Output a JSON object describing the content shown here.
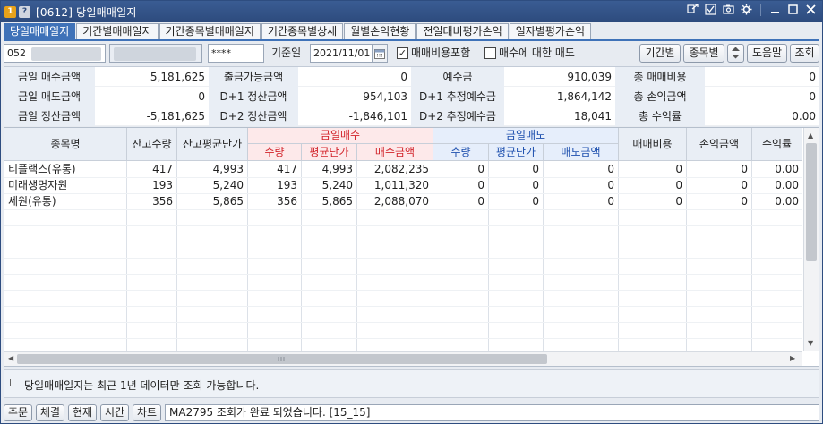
{
  "window": {
    "badge_1": "1",
    "badge_q": "?",
    "title": "[0612] 당일매매일지"
  },
  "tabs": [
    {
      "label": "당일매매일지",
      "active": true
    },
    {
      "label": "기간별매매일지",
      "active": false
    },
    {
      "label": "기간종목별매매일지",
      "active": false
    },
    {
      "label": "기간종목별상세",
      "active": false
    },
    {
      "label": "월별손익현황",
      "active": false
    },
    {
      "label": "전일대비평가손익",
      "active": false
    },
    {
      "label": "일자별평가손익",
      "active": false
    }
  ],
  "query": {
    "account_prefix": "052",
    "password": "****",
    "date_label": "기준일",
    "date_value": "2021/11/01",
    "include_fee_label": "매매비용포함",
    "include_fee_checked": true,
    "sell_on_buy_label": "매수에 대한 매도",
    "sell_on_buy_checked": false,
    "btn_period": "기간별",
    "btn_item": "종목별",
    "btn_help": "도움말",
    "btn_query": "조회"
  },
  "summary": {
    "rows": [
      [
        {
          "label": "금일 매수금액",
          "value": "5,181,625"
        },
        {
          "label": "출금가능금액",
          "value": "0"
        },
        {
          "label": "예수금",
          "value": "910,039"
        },
        {
          "label": "총 매매비용",
          "value": "0"
        }
      ],
      [
        {
          "label": "금일 매도금액",
          "value": "0"
        },
        {
          "label": "D+1 정산금액",
          "value": "954,103"
        },
        {
          "label": "D+1 추정예수금",
          "value": "1,864,142"
        },
        {
          "label": "총 손익금액",
          "value": "0"
        }
      ],
      [
        {
          "label": "금일 정산금액",
          "value": "-5,181,625"
        },
        {
          "label": "D+2 정산금액",
          "value": "-1,846,101"
        },
        {
          "label": "D+2 추정예수금",
          "value": "18,041"
        },
        {
          "label": "총 수익률",
          "value": "0.00"
        }
      ]
    ]
  },
  "table": {
    "headers": {
      "name": "종목명",
      "hold_qty": "잔고수량",
      "hold_avg": "잔고평균단가",
      "buy_group": "금일매수",
      "buy_qty": "수량",
      "buy_avg": "평균단가",
      "buy_amt": "매수금액",
      "sell_group": "금일매도",
      "sell_qty": "수량",
      "sell_avg": "평균단가",
      "sell_amt": "매도금액",
      "fee": "매매비용",
      "pnl": "손익금액",
      "rate": "수익률"
    },
    "rows": [
      [
        "티플랙스(유통)",
        "417",
        "4,993",
        "417",
        "4,993",
        "2,082,235",
        "0",
        "0",
        "0",
        "0",
        "0",
        "0.00"
      ],
      [
        "미래생명자원",
        "193",
        "5,240",
        "193",
        "5,240",
        "1,011,320",
        "0",
        "0",
        "0",
        "0",
        "0",
        "0.00"
      ],
      [
        "세원(유통)",
        "356",
        "5,865",
        "356",
        "5,865",
        "2,088,070",
        "0",
        "0",
        "0",
        "0",
        "0",
        "0.00"
      ]
    ]
  },
  "notice": "당일매매일지는 최근 1년 데이터만 조회 가능합니다.",
  "statusbar": {
    "buttons": [
      "주문",
      "체결",
      "현재",
      "시간",
      "차트"
    ],
    "message": "MA2795 조회가 완료 되었습니다. [15_15]"
  }
}
